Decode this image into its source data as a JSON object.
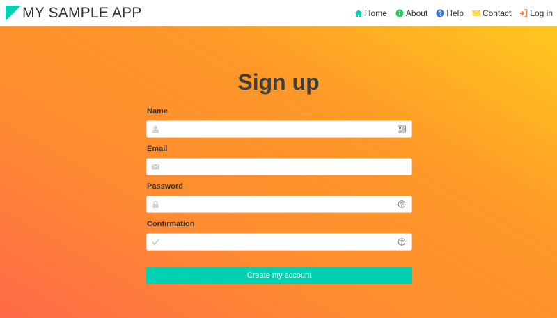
{
  "brand": {
    "name": "MY SAMPLE APP",
    "logo_icon": "triangle-logo-icon",
    "logo_color": "#00d1b2"
  },
  "nav": [
    {
      "label": "Home",
      "icon": "home-icon",
      "icon_color": "#00d1b2"
    },
    {
      "label": "About",
      "icon": "info-icon",
      "icon_color": "#23d160"
    },
    {
      "label": "Help",
      "icon": "question-icon",
      "icon_color": "#3273dc"
    },
    {
      "label": "Contact",
      "icon": "envelope-icon",
      "icon_color": "#ffdd57"
    },
    {
      "label": "Log in",
      "icon": "sign-in-icon",
      "icon_color": "#ff7d3a"
    }
  ],
  "form": {
    "title": "Sign up",
    "fields": [
      {
        "label": "Name",
        "value": "",
        "left_icon": "user-icon",
        "right_icon": "id-card-icon"
      },
      {
        "label": "Email",
        "value": "",
        "left_icon": "envelope-icon"
      },
      {
        "label": "Password",
        "value": "",
        "left_icon": "lock-icon",
        "right_icon": "fingerprint-icon"
      },
      {
        "label": "Confirmation",
        "value": "",
        "left_icon": "check-icon",
        "right_icon": "fingerprint-icon"
      }
    ],
    "submit_label": "Create my account"
  },
  "colors": {
    "accent": "#00d1b2",
    "title_text": "#3d3f3c",
    "gradient_start": "#ff6a48",
    "gradient_end": "#ffc81e"
  }
}
